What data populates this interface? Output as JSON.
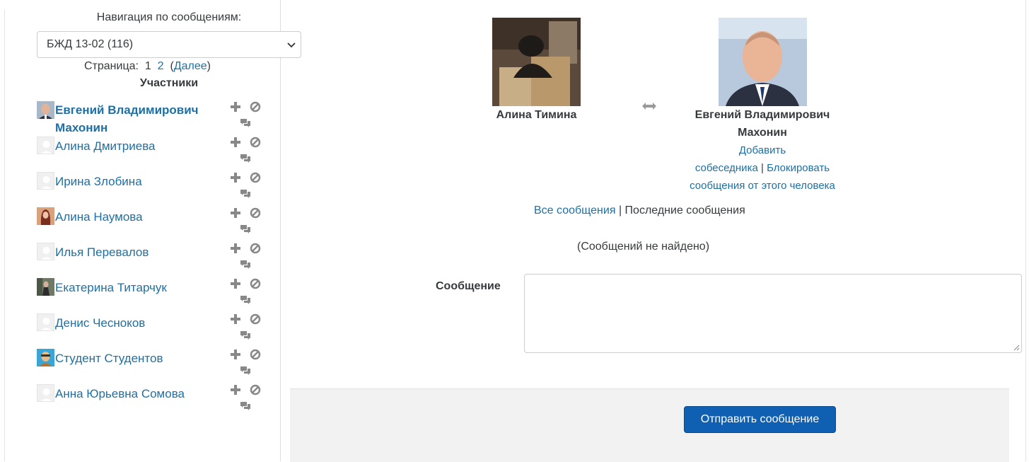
{
  "sidebar": {
    "nav_label": "Навигация по сообщениям:",
    "course_select": "БЖД 13-02 (116)",
    "pager": {
      "label": "Страница:",
      "current": "1",
      "page2": "2",
      "next": "Далее"
    },
    "participants_title": "Участники",
    "contacts": [
      {
        "name": "Евгений Владимирович Махонин",
        "active": true,
        "avatar": "photo"
      },
      {
        "name": "Алина Дмитриева",
        "active": false,
        "avatar": "blank"
      },
      {
        "name": "Ирина Злобина",
        "active": false,
        "avatar": "blank"
      },
      {
        "name": "Алина Наумова",
        "active": false,
        "avatar": "photo"
      },
      {
        "name": "Илья Перевалов",
        "active": false,
        "avatar": "blank"
      },
      {
        "name": "Екатерина Титарчук",
        "active": false,
        "avatar": "photo"
      },
      {
        "name": "Денис Чесноков",
        "active": false,
        "avatar": "blank"
      },
      {
        "name": "Студент Студентов",
        "active": false,
        "avatar": "photo"
      },
      {
        "name": "Анна Юрьевна Сомова",
        "active": false,
        "avatar": "blank"
      }
    ],
    "contact_icons": {
      "add": "plus-icon",
      "block": "block-icon",
      "messages": "messages-icon"
    }
  },
  "conversation": {
    "left_user": "Алина Тимина",
    "right_user_line1": "Евгений Владимирович",
    "right_user_line2": "Махонин",
    "add_contact_line1": "Добавить",
    "add_contact_line2": "собеседника",
    "separator": "|",
    "block_line1": "Блокировать",
    "block_line2": "сообщения от этого человека",
    "swap_icon": "swap-arrows-icon"
  },
  "filters": {
    "all": "Все сообщения",
    "separator": "|",
    "recent": "Последние сообщения"
  },
  "empty_note": "(Сообщений не найдено)",
  "compose": {
    "label": "Сообщение",
    "value": "",
    "send_label": "Отправить сообщение"
  },
  "colors": {
    "link": "#1d70a5",
    "primary_button": "#0f5fb3",
    "footer_bg": "#f2f2f2"
  }
}
